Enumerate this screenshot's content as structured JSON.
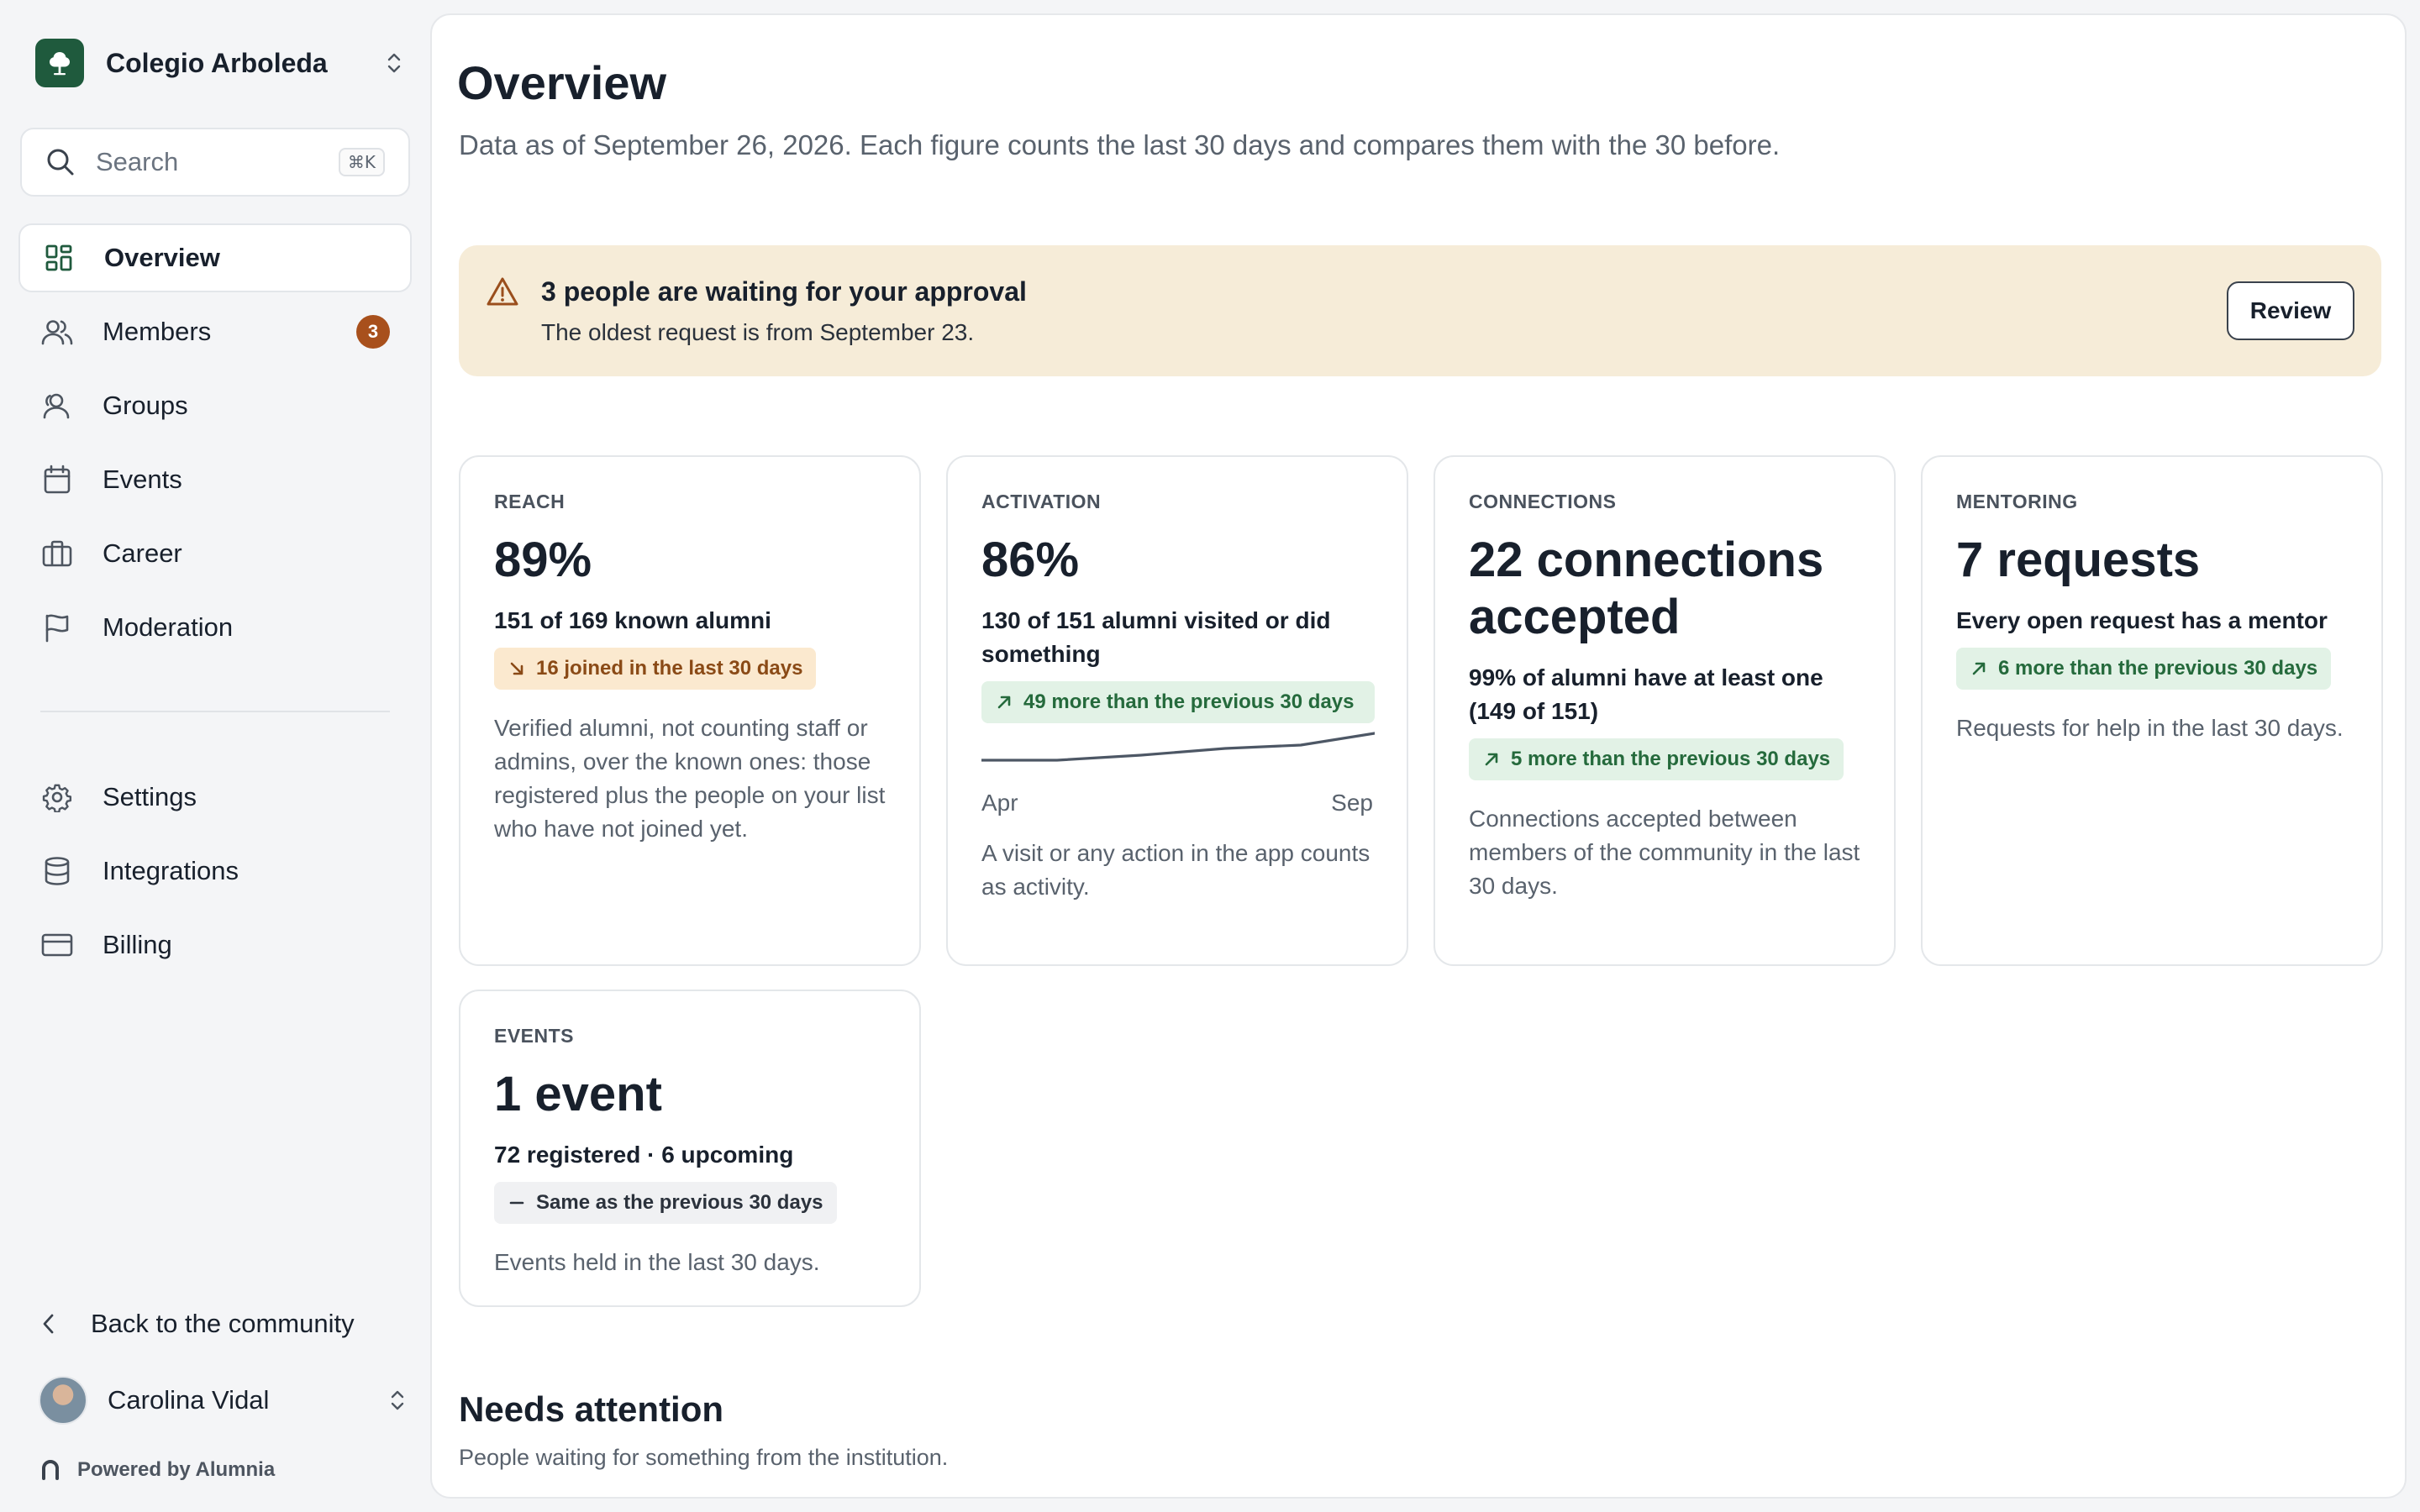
{
  "sidebar": {
    "org_name": "Colegio Arboleda",
    "search": {
      "placeholder": "Search",
      "shortcut": "⌘K"
    },
    "items": [
      {
        "label": "Overview",
        "icon": "dashboard-icon",
        "active": true
      },
      {
        "label": "Members",
        "icon": "users-icon",
        "badge": "3"
      },
      {
        "label": "Groups",
        "icon": "user-group-icon"
      },
      {
        "label": "Events",
        "icon": "calendar-icon"
      },
      {
        "label": "Career",
        "icon": "briefcase-icon"
      },
      {
        "label": "Moderation",
        "icon": "flag-icon"
      }
    ],
    "secondary_items": [
      {
        "label": "Settings",
        "icon": "gear-icon"
      },
      {
        "label": "Integrations",
        "icon": "database-icon"
      },
      {
        "label": "Billing",
        "icon": "credit-card-icon"
      }
    ],
    "back_label": "Back to the community",
    "user_name": "Carolina Vidal",
    "powered_by": "Powered by Alumnia"
  },
  "main": {
    "title": "Overview",
    "subtitle": "Data as of September 26, 2026. Each figure counts the last 30 days and compares them with the 30 before.",
    "alert": {
      "title": "3 people are waiting for your approval",
      "description": "The oldest request is from September 23.",
      "button": "Review"
    },
    "cards": {
      "reach": {
        "label": "REACH",
        "value": "89%",
        "detail": "151 of 169 known alumni",
        "pill": "16 joined in the last 30 days",
        "description": "Verified alumni, not counting staff or admins, over the known ones: those registered plus the people on your list who have not joined yet."
      },
      "activation": {
        "label": "ACTIVATION",
        "value": "86%",
        "detail": "130 of 151 alumni visited or did something",
        "pill": "49 more than the previous 30 days",
        "spark_start": "Apr",
        "spark_end": "Sep",
        "description": "A visit or any action in the app counts as activity."
      },
      "connections": {
        "label": "CONNECTIONS",
        "value": "22 connections accepted",
        "detail": "99% of alumni have at least one (149 of 151)",
        "pill": "5 more than the previous 30 days",
        "description": "Connections accepted between members of the community in the last 30 days."
      },
      "mentoring": {
        "label": "MENTORING",
        "value": "7 requests",
        "detail": "Every open request has a mentor",
        "pill": "6 more than the previous 30 days",
        "description": "Requests for help in the last 30 days."
      },
      "events": {
        "label": "EVENTS",
        "value": "1 event",
        "detail": "72 registered · 6 upcoming",
        "pill": "Same as the previous 30 days",
        "description": "Events held in the last 30 days."
      }
    },
    "needs_attention": {
      "title": "Needs attention",
      "subtitle": "People waiting for something from the institution."
    }
  },
  "colors": {
    "brand": "#1f5a3d",
    "badge": "#a8501c",
    "alert_bg": "#f6ecd8",
    "positive_bg": "#e2f2e6",
    "positive_text": "#256a3c",
    "warn_bg": "#fbe9cf",
    "warn_text": "#8a4a16"
  }
}
